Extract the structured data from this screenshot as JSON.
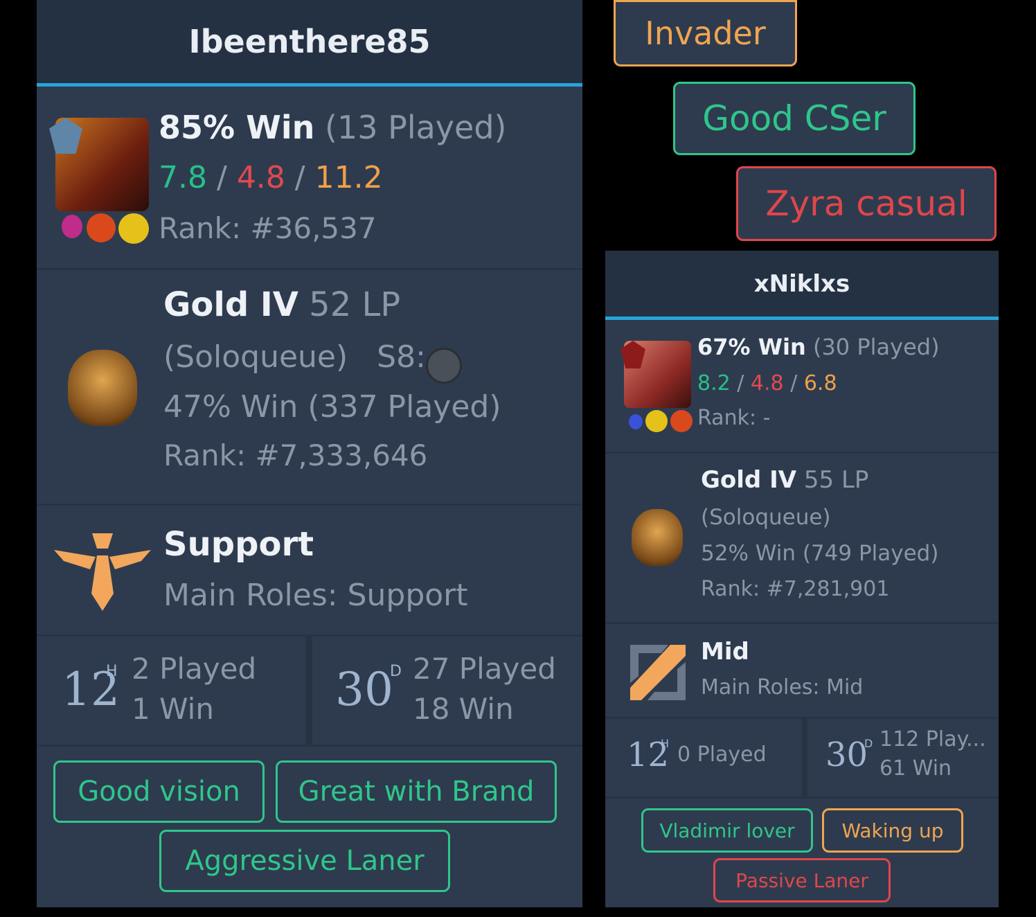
{
  "left": {
    "name": "Ibeenthere85",
    "recent": {
      "win": "85% Win",
      "played": "(13 Played)",
      "kills": "7.8",
      "deaths": "4.8",
      "assists": "11.2",
      "sep": "/",
      "rank": "Rank: #36,537"
    },
    "ranked": {
      "tier": "Gold IV",
      "lp": "52 LP",
      "queue": "(Soloqueue)",
      "season": "S8:",
      "winrate": "47% Win (337 Played)",
      "rank": "Rank: #7,333,646"
    },
    "role": {
      "title": "Support",
      "main": "Main Roles: Support"
    },
    "stats": [
      {
        "num": "12",
        "unit": "H",
        "played": "2 Played",
        "win": "1 Win"
      },
      {
        "num": "30",
        "unit": "D",
        "played": "27 Played",
        "win": "18 Win"
      }
    ],
    "tags": [
      "Good vision",
      "Great with Brand",
      "Aggressive Laner"
    ]
  },
  "floating_tags": [
    "Invader",
    "Good CSer",
    "Zyra casual"
  ],
  "right": {
    "name": "xNiklxs",
    "recent": {
      "win": "67% Win",
      "played": "(30 Played)",
      "kills": "8.2",
      "deaths": "4.8",
      "assists": "6.8",
      "sep": "/",
      "rank": "Rank: -"
    },
    "ranked": {
      "tier": "Gold IV",
      "lp": "55 LP",
      "queue": "(Soloqueue)",
      "winrate": "52% Win (749 Played)",
      "rank": "Rank: #7,281,901"
    },
    "role": {
      "title": "Mid",
      "main": "Main Roles: Mid"
    },
    "stats": [
      {
        "num": "12",
        "unit": "H",
        "played": "0 Played"
      },
      {
        "num": "30",
        "unit": "D",
        "played": "112 Play...",
        "win": "61 Win"
      }
    ],
    "tags": [
      "Vladimir lover",
      "Waking up",
      "Passive Laner"
    ]
  },
  "colors": {
    "panel": "#2e3b4e",
    "header": "#243142",
    "accent": "#27a4d8",
    "green": "#2fc68b",
    "red": "#e0464b",
    "orange": "#f0a550"
  },
  "icons": [
    "champion-portrait",
    "rank-badge",
    "helmet-emblem",
    "support-role-icon",
    "mid-role-icon",
    "summoner-spell-icon"
  ]
}
